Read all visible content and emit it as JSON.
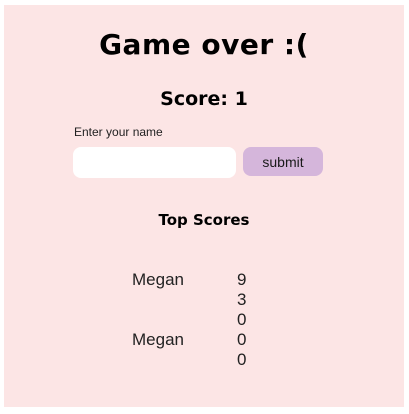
{
  "header": {
    "title": "Game over :(",
    "score_text": "Score: 1"
  },
  "form": {
    "name_label": "Enter your name",
    "name_value": "",
    "submit_label": "submit"
  },
  "leaderboard": {
    "title": "Top Scores",
    "entries": [
      {
        "name": "Megan",
        "score": "9"
      },
      {
        "name": "",
        "score": "3"
      },
      {
        "name": "",
        "score": "0"
      },
      {
        "name": "Megan",
        "score": "0"
      },
      {
        "name": "",
        "score": "0"
      }
    ]
  },
  "colors": {
    "panel_background": "#fce5e5",
    "submit_button": "#d5b6db",
    "input_background": "#ffffff"
  }
}
